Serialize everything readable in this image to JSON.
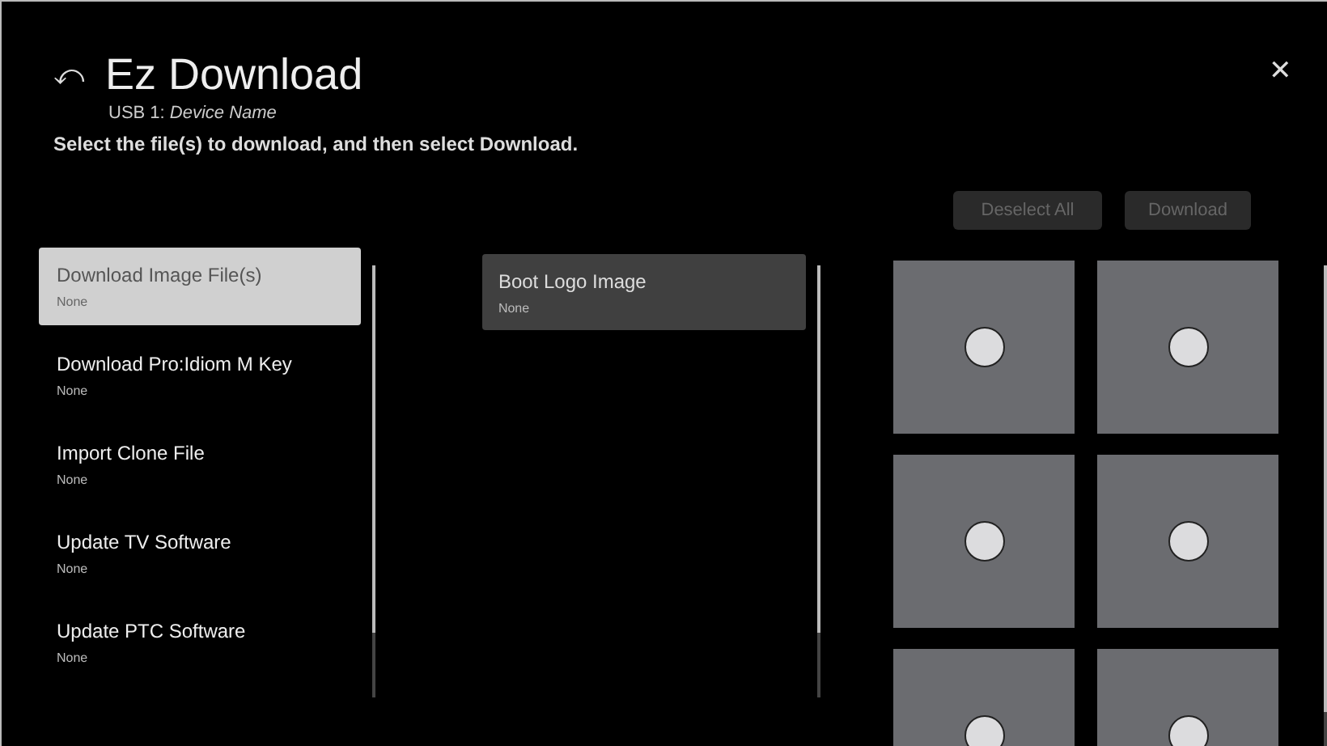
{
  "header": {
    "back_icon": "⤺",
    "title": "Ez Download",
    "device_label": "USB 1:",
    "device_name": "Device Name",
    "instruction": "Select the file(s) to download, and then select Download.",
    "close": "✕"
  },
  "actions": [
    {
      "label": "Deselect All",
      "disabled": true
    },
    {
      "label": "Download",
      "disabled": true
    }
  ],
  "categories": [
    {
      "title": "Download Image File(s)",
      "subtitle": "None",
      "selected": true
    },
    {
      "title": "Download Pro:Idiom M Key",
      "subtitle": "None",
      "selected": false
    },
    {
      "title": "Import Clone File",
      "subtitle": "None",
      "selected": false
    },
    {
      "title": "Update TV Software",
      "subtitle": "None",
      "selected": false
    },
    {
      "title": "Update PTC Software",
      "subtitle": "None",
      "selected": false
    }
  ],
  "files": [
    {
      "title": "Boot Logo Image",
      "subtitle": "None",
      "selected": true
    }
  ],
  "tiles": [
    {
      "checked": false
    },
    {
      "checked": false
    },
    {
      "checked": false
    },
    {
      "checked": false
    },
    {
      "checked": false
    },
    {
      "checked": false
    }
  ]
}
